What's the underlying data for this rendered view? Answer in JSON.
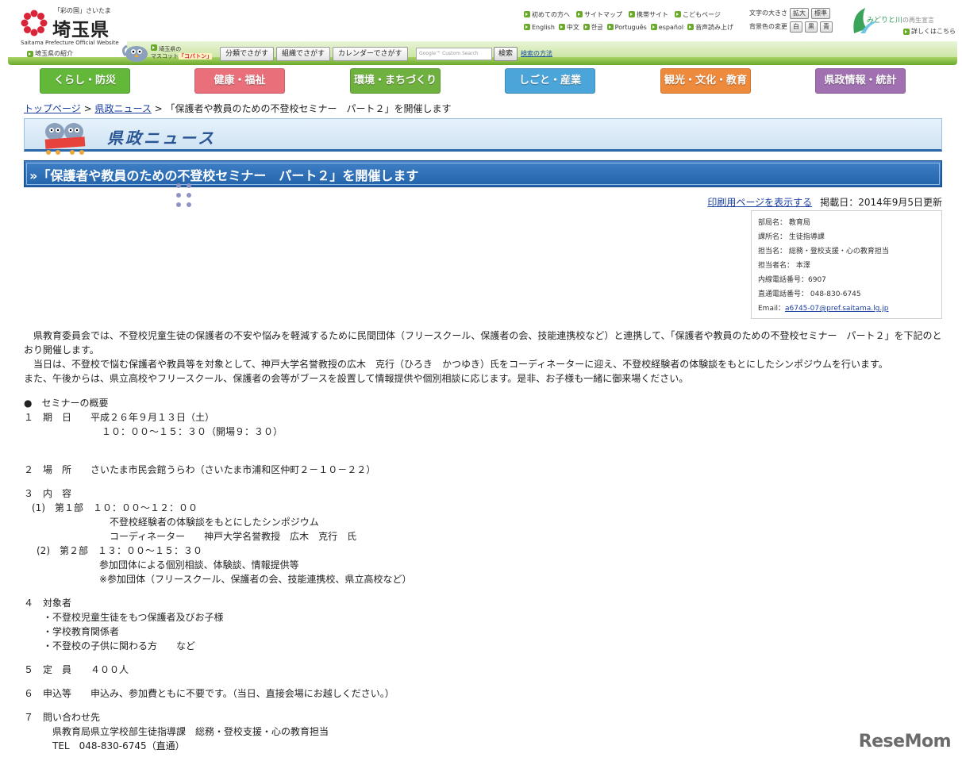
{
  "header": {
    "logo_small": "「彩の国」さいたま",
    "logo_name": "埼玉県",
    "logo_en": "Saitama Prefecture Official Website",
    "intro_link": "埼玉県の紹介",
    "mascot_line1": "埼玉県の",
    "mascot_line2_prefix": "マスコット",
    "mascot_name": "「コバトン」",
    "search_buttons": [
      "分類でさがす",
      "組織でさがす",
      "カレンダーでさがす"
    ],
    "google_placeholder": "Google™ Custom Search",
    "search_button": "検索",
    "search_help": "検索の方法",
    "top_links_row1": [
      "初めての方へ",
      "サイトマップ",
      "携帯サイト",
      "こどもページ"
    ],
    "top_links_row2": [
      "English",
      "中文",
      "한글",
      "Português",
      "español",
      "音声読み上げ"
    ],
    "font_size_label": "文字の大きさ",
    "font_enlarge": "拡大",
    "font_standard": "標準",
    "bg_color_label": "背景色の変更",
    "bg_white": "白",
    "bg_black": "黒",
    "bg_blue": "青",
    "midori_text": "みどりと川",
    "midori_sub": "の再生宣言",
    "detail_link": "詳しくはこちら"
  },
  "categories": [
    {
      "label": "くらし・防災",
      "color": "#63b83a"
    },
    {
      "label": "健康・福祉",
      "color": "#e9707a"
    },
    {
      "label": "環境・まちづくり",
      "color": "#6fb13e"
    },
    {
      "label": "しごと・産業",
      "color": "#4ca5d9"
    },
    {
      "label": "観光・文化・教育",
      "color": "#ee8a3c"
    },
    {
      "label": "県政情報・統計",
      "color": "#a070b0"
    }
  ],
  "breadcrumb": {
    "home": "トップページ",
    "sep": " > ",
    "news": "県政ニュース",
    "current": "「保護者や教員のための不登校セミナー　パート２」を開催します"
  },
  "section_title": "県政ニュース",
  "page_title": "»「保護者や教員のための不登校セミナー　パート２」を開催します",
  "meta": {
    "print_link": "印刷用ページを表示する",
    "date": "掲載日：2014年9月5日更新"
  },
  "contact": {
    "lines": [
      "部局名：  教育局",
      "課所名：  生徒指導課",
      "担当名：  総務・登校支援・心の教育担当",
      "担当者名：  本澤",
      "内線電話番号：6907",
      "直通電話番号：  048-830-6745"
    ],
    "email_label": "Email：",
    "email": "a6745-07@pref.saitama.lg.jp"
  },
  "body": {
    "para1": "　県教育委員会では、不登校児童生徒の保護者の不安や悩みを軽減するために民間団体（フリースクール、保護者の会、技能連携校など）と連携して、「保護者や教員のための不登校セミナー　パート２」を下記のとおり開催します。",
    "para2": "　当日は、不登校で悩む保護者や教員等を対象として、神戸大学名誉教授の広木　克行（ひろき　かつゆき）氏をコーディネーターに迎え、不登校経験者の体験談をもとにしたシンポジウムを行います。",
    "para3": "また、午後からは、県立高校やフリースクール、保護者の会等がブースを設置して情報提供や個別相談に応じます。是非、お子様も一緒に御来場ください。",
    "outline": "●　セミナーの概要",
    "l1a": "１　期　日　　平成２６年９月１３日（土）",
    "l1b": "１０：００～１５：３０（開場９：３０）",
    "l2": "２　場　所　　さいたま市民会館うらわ（さいたま市浦和区仲町２－１０－２２）",
    "l3": "３　内　容",
    "l3a": "(1)　第１部　１０：００～１２：００",
    "l3a1": "不登校経験者の体験談をもとにしたシンポジウム",
    "l3a2": "コーディネーター　　神戸大学名誉教授　広木　克行　氏",
    "l3b": "(2)　第２部　１３：００～１５：３０",
    "l3b1": "参加団体による個別相談、体験談、情報提供等",
    "l3b2": "※参加団体（フリースクール、保護者の会、技能連携校、県立高校など）",
    "l4": "４　対象者",
    "l4a": "・不登校児童生徒をもつ保護者及びお子様",
    "l4b": "・学校教育関係者",
    "l4c": "・不登校の子供に関わる方　　など",
    "l5": "５　定　員　　４００人",
    "l6": "６　申込等　　申込み、参加費ともに不要です。（当日、直接会場にお越しください。）",
    "l7": "７　問い合わせ先",
    "l7a": "県教育局県立学校部生徒指導課　総務・登校支援・心の教育担当",
    "l7b": "TEL　048-830-6745（直通）"
  },
  "watermark": "ReseMom"
}
